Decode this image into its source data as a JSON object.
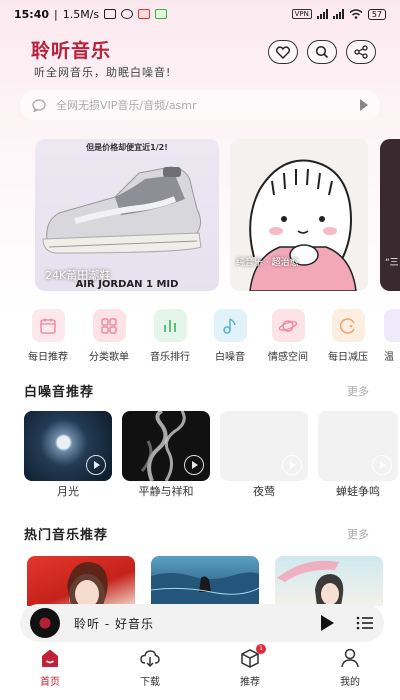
{
  "status_bar": {
    "time": "15:40",
    "speed": "1.5M/s",
    "vpn": "VPN",
    "battery": "57"
  },
  "header": {
    "title": "聆听音乐",
    "subtitle": "听全网音乐，助眠白噪音!",
    "icons": [
      "heart-icon",
      "search-icon",
      "share-icon"
    ]
  },
  "search": {
    "placeholder": "全网无损VIP音乐/音频/asmr"
  },
  "banners": [
    {
      "promo": "但是价格却便宜近1/2!",
      "caption": "24K莆田潮鞋",
      "model": "AIR JORDAN 1 MID"
    },
    {
      "caption": "纯音乐 · 超治愈"
    },
    {
      "caption": "“三"
    }
  ],
  "categories": [
    {
      "label": "每日推荐",
      "color": "#f7b3c4",
      "bg": "#fde8ee"
    },
    {
      "label": "分类歌单",
      "color": "#f08aa0",
      "bg": "#fde3e8"
    },
    {
      "label": "音乐排行",
      "color": "#5cc17a",
      "bg": "#e3f6e9"
    },
    {
      "label": "白噪音",
      "color": "#55b5d0",
      "bg": "#e1f3f8"
    },
    {
      "label": "情感空间",
      "color": "#f08aa0",
      "bg": "#fde3e8"
    },
    {
      "label": "每日减压",
      "color": "#f2a36a",
      "bg": "#fdeee2"
    },
    {
      "label": "温",
      "color": "#9c8ae0",
      "bg": "#eeeafc"
    }
  ],
  "white_noise": {
    "title": "白噪音推荐",
    "more": "更多",
    "items": [
      {
        "label": "月光"
      },
      {
        "label": "平静与祥和"
      },
      {
        "label": "夜莺"
      },
      {
        "label": "蝉蛙争鸣"
      }
    ]
  },
  "hot_music": {
    "title": "热门音乐推荐",
    "more": "更多"
  },
  "player": {
    "track": "聆听 - 好音乐"
  },
  "nav": {
    "items": [
      {
        "label": "首页",
        "active": true
      },
      {
        "label": "下载",
        "active": false
      },
      {
        "label": "推荐",
        "active": false,
        "badge": "1"
      },
      {
        "label": "我的",
        "active": false
      }
    ]
  },
  "colors": {
    "brand": "#b81f3a",
    "active_nav": "#c0203c",
    "badge": "#e02a3a"
  }
}
